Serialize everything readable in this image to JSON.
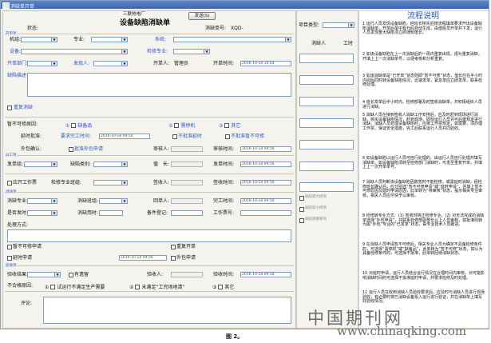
{
  "window": {
    "title": "消缺单开单",
    "figure_caption": "图 2。"
  },
  "header": {
    "company": "三联热电厂",
    "form_title": "设备缺陷消缺单",
    "send_button": "发送(S)",
    "status_label": "状态:",
    "ticket_no_label": "消缺单号:",
    "ticket_no_value": "XQD-",
    "project_type_label": "项目类型:"
  },
  "sections": {
    "open_ticket": "开单项",
    "dispatch": "派工项",
    "handle": "消缺项",
    "acceptance": "验收项"
  },
  "open": {
    "unit_label": "机组:",
    "specialty_label": "专业:",
    "system_label": "系统:",
    "equipment_label": "设备:",
    "check_item_label": "检修专业:",
    "dept_label": "开单部门:",
    "finder_label": "发现人:",
    "opener_label": "开单人:",
    "opener_value": "管理员",
    "open_time_label": "开单时间:",
    "open_time_value": "2016-10-18 10:04",
    "desc_label": "缺陷描述:",
    "repeat_label": "重复消缺"
  },
  "cannot": {
    "label": "暂不可修原因:",
    "opt1": "缺备品",
    "opt2": "需停机",
    "opt3": "其它",
    "delay_label": "延时批准:",
    "required_time_label": "要求完工时间:",
    "required_time_value": "2016-10-18 09:56",
    "no_delay_label": "不批准延时",
    "no_cannot_label": "不批准暂不可修"
  },
  "outsource": {
    "label": "外包确认:",
    "agree_label": "批准外包申请",
    "reviewer_label": "审核人:",
    "review_time_label": "审核时间:",
    "review_time_value": "2016-10-18 09:56"
  },
  "dispatch": {
    "unit_label": "发单组:",
    "defect_type_label": "缺陷类别:",
    "duty_label": "值　长:",
    "dispatch_time_label": "发单时间:",
    "dispatch_time_value": "2016-10-18 09:56",
    "sub_label": "应开工作票",
    "checker_label": "检修专业班组:",
    "sign_label": "签收人:",
    "sign_time_label": "签收时间:",
    "sign_time_value": "2016-10-18 09:56"
  },
  "handle": {
    "handle_spec_label": "消缺专业:",
    "handle_group_label": "消缺班组:",
    "handler_label": "回单人:",
    "finish_time_label": "完工时间:",
    "finish_time_value": "2016-10-18 09:56",
    "defect_level_label": "是否发时:",
    "handle_time_label": "消缺用时:",
    "spare_label": "备件登记:",
    "ticket_label": "工作票号:",
    "process_label": "处理方式:",
    "cannot_apply": "暂不可修申请",
    "repeat_open": "重复开单",
    "delay_apply": "延时申请",
    "delay_time_value": "2016-10-18 09:56",
    "outsource_apply": "外包申请"
  },
  "accept": {
    "result_label": "验收结果:",
    "leftover_label": "有遗留",
    "acceptor_label": "验收人:",
    "accept_time_label": "验收时间:",
    "accept_time_value": "2016-10-18 09:56",
    "reason_label": "不合格原因:",
    "r1": "试运行不满足生产需要",
    "r2": "未满足“工完场地清”",
    "r3": "其它",
    "comment_label": "评论:"
  },
  "side": {
    "col1": "消缺人",
    "col2": "工时",
    "chk1": "缺陷转大修项",
    "chk2": "缺陷转小修项",
    "chk3": "缺陷转重要项"
  },
  "doc": {
    "title": "流程说明",
    "paras": [
      "1 运行人员发现设备缺陷，经班长核实后按流程填单要求开出设备缺陷消缺单，开单后单中有代码自动生成，由值班员开单并下发，运行人员发现重大缺陷须立即通知值长。",
      "2 如该设备缺陷在上一次消缺后的一周内重复出现，视为重复消缺，开填上上一次消缺单号，以便考核和分析重复。",
      "3 如该消缺单是“已开单”状态则即“暂不可修”状态，值长应在半小时内阅后同时转设备缺陷情况，迅速发单，紧急单应立即发单，联系检修处理。",
      "4 值长发单后半小时内，检修部署及时签收消缺单，并积极组织人员进行消缺。",
      "5 消缺人员在接到签收人消缺工作安排后，应及时赶到现场进行消缺，核实设备缺陷情况，赶到现场，即刻运行人员许可后按规定进行消缺，消缺人员处理设备缺陷时，应按工作票规定，如需要，须办理工作票，保证安全措施，完工后联系运行人员共同验收。",
      "6 如设备缺陷以运行人员可自行处理的，由运行人员自行处理并填写消缺单，如设备缺陷须转至检修部门消缺时，可发至重复开单，并填上上一次开单单号。",
      "7 消缺人员判断该设备缺陷因故暂时不能检修，或需延时消缺，经检修班长确认后，应分别选“暂不可修申请”或“延时申请”，并填上暂不可修原因及延时申请原因，此单转为“待审核”状态，提示相关专业审核，相关人员应尽快予以审核。",
      "8 检修转专业方式：(1) 签收时转正检修专业，(2) 对无法完成的消缺单选择“外包申请”，并联系检修部副部长以上人员审核，如批准则转为属“外包”专业的“已发单”状态，由专业技术人员跟进。",
      "9 在消缺人员申请暂不可修后，相关专业人员为确定不具备检修条件的，可选择“需停机”或“缺备品”，此单转为“暂不可修”状态，如认为具备检修条件的，可选择不批准，此单转回待消缺状态。",
      "10 对延时申请，运行人员结合运行情况在合理时间内审核，对可能影响消缺时间的可选择不批准延时申请，并要求检修及时处理。",
      "11 运行人员在收到消缺人员验收要求后，应及时与消缺人员进行现场验收，有必要时将已消缺设备投入运行进行验证，并在消缺单上填写好验收情况。"
    ]
  },
  "watermark": {
    "cn": "中国期刊网",
    "url": "www.chinaqking.com"
  }
}
